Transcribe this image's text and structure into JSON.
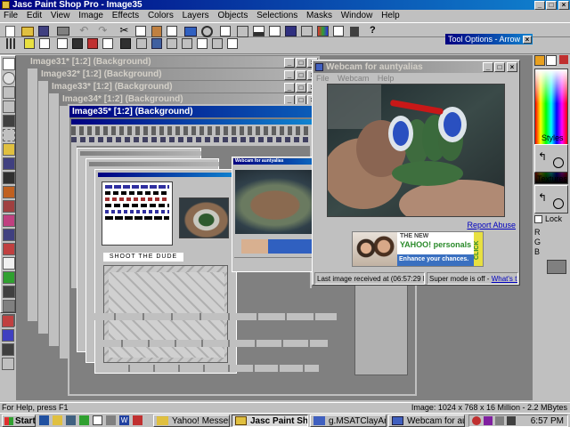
{
  "app": {
    "title": "Jasc Paint Shop Pro - Image35"
  },
  "menu": [
    "File",
    "Edit",
    "View",
    "Image",
    "Effects",
    "Colors",
    "Layers",
    "Objects",
    "Selections",
    "Masks",
    "Window",
    "Help"
  ],
  "tool_options": {
    "title": "Tool Options - Arrow"
  },
  "doc_windows": [
    {
      "title": "Image31* [1:2] (Background)"
    },
    {
      "title": "Image32* [1:2] (Background)"
    },
    {
      "title": "Image33* [1:2] (Background)"
    },
    {
      "title": "Image34* [1:2] (Background)"
    },
    {
      "title": "Image35* [1:2] (Background)"
    }
  ],
  "webcam": {
    "title": "Webcam for auntyalias",
    "menu": [
      "File",
      "Webcam",
      "Help"
    ],
    "report_abuse": "Report Abuse",
    "ad": {
      "line1": "THE NEW",
      "brand": "YAHOO! personals",
      "tagline": "Enhance your chances.",
      "click": "CLICK"
    },
    "status_last": "Last image received at (06:57:29 PM)",
    "status_super": "Super mode is off -",
    "whats_this": "What's this?"
  },
  "color_panel": {
    "styles_label": "Styles",
    "textures_label": "Textures",
    "lock_label": "Lock",
    "rgb_labels": [
      "R",
      "G",
      "B"
    ],
    "swatch_colors": [
      "#e8a020",
      "#ffffff"
    ]
  },
  "inner_screens": {
    "banner_text": "SHOOT THE DUDE",
    "inner_webcam_title": "Webcam for auntyalias"
  },
  "statusbar": {
    "left": "For Help, press F1",
    "right": "Image:  1024 x 768 x 16 Million - 2.2 MBytes"
  },
  "taskbar": {
    "start": "Start",
    "buttons": [
      {
        "label": "Yahoo! Messenger"
      },
      {
        "label": "Jasc Paint Shop ..."
      },
      {
        "label": "g.MSATClayArt:1 -..."
      },
      {
        "label": "Webcam for auntyalias"
      }
    ],
    "clock": "6:57 PM"
  }
}
